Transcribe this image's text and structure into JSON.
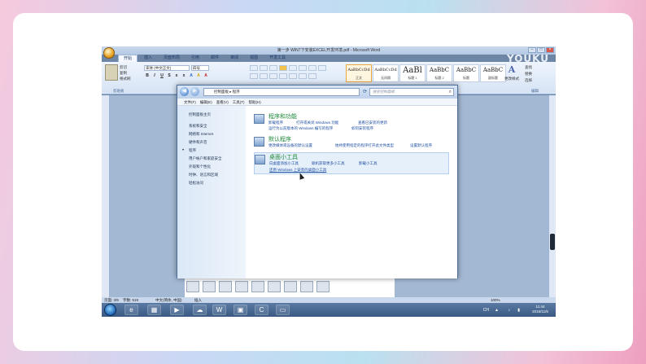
{
  "word": {
    "title": "第一步 WIN7下安装EXCEL开发环境.pdf - Microsoft Word",
    "ribbon_tabs": [
      "开始",
      "插入",
      "页面布局",
      "引用",
      "邮件",
      "审阅",
      "视图",
      "开发工具"
    ],
    "clipboard": {
      "cut": "剪切",
      "copy": "复制",
      "format_painter": "格式刷",
      "group": "剪贴板"
    },
    "font": {
      "name": "宋体 (中文正文)",
      "size": "四号",
      "group": "字体"
    },
    "paragraph_group": "段落",
    "styles": [
      {
        "sample": "AaBbCcDd",
        "name": "正文"
      },
      {
        "sample": "AaBbCcDd",
        "name": "无间隔"
      },
      {
        "sample": "AaBl",
        "name": "标题 1"
      },
      {
        "sample": "AaBbC",
        "name": "标题 2"
      },
      {
        "sample": "AaBbC",
        "name": "标题"
      },
      {
        "sample": "AaBbC",
        "name": "副标题"
      }
    ],
    "change_style": "更改样式",
    "edit_group": {
      "find": "查找",
      "replace": "替换",
      "select": "选择",
      "group": "编辑"
    },
    "status": {
      "page": "页面: 3/9",
      "words": "字数: 519",
      "lang": "中文(简体, 中国)",
      "mode": "插入"
    },
    "zoom": "100%"
  },
  "watermark": "YOUKU",
  "control_panel": {
    "address": [
      "控制面板",
      "程序"
    ],
    "search_placeholder": "搜索控制面板",
    "menu": [
      "文件(F)",
      "编辑(E)",
      "查看(V)",
      "工具(T)",
      "帮助(H)"
    ],
    "left_nav": [
      "控制面板主页",
      "系统和安全",
      "网络和 Internet",
      "硬件和声音",
      "程序",
      "用户帐户和家庭安全",
      "外观和个性化",
      "时钟、语言和区域",
      "轻松访问"
    ],
    "current_nav": "程序",
    "categories": [
      {
        "title": "程序和功能",
        "links": [
          "卸载程序",
          "打开或关闭 Windows 功能",
          "查看已安装的更新",
          "运行为以前版本的 Windows 编写的程序",
          "如何安装程序"
        ]
      },
      {
        "title": "默认程序",
        "links": [
          "更改媒体或设备的默认设置",
          "始终使用指定的程序打开此文件类型",
          "设置默认程序"
        ]
      },
      {
        "title": "桌面小工具",
        "links": [
          "向桌面添加小工具",
          "联机获取更多小工具",
          "卸载小工具",
          "还原 Windows 上安装的桌面小工具"
        ]
      }
    ]
  },
  "taskbar": {
    "time": "11:44",
    "date": "2015/11/5",
    "lang": "CH"
  },
  "colors": {
    "accent_green": "#1f8a3b",
    "link_blue": "#1f4fa0",
    "taskbar": "#3a5a84"
  }
}
